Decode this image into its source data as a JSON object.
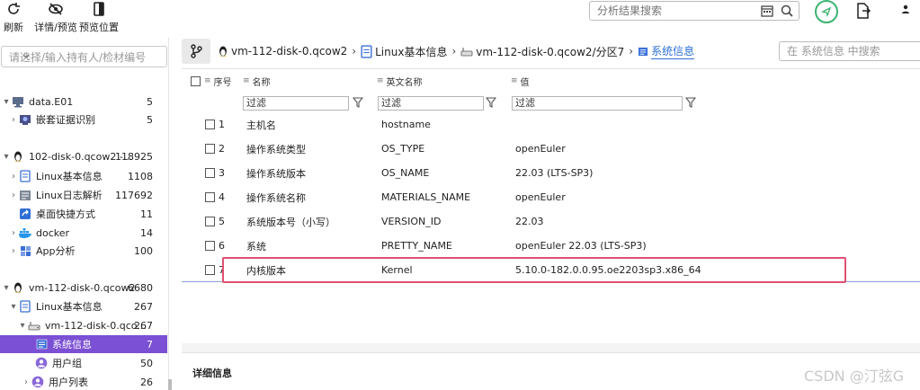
{
  "toolbar": {
    "refresh_label": "刷新",
    "details_label": "详情/预览",
    "preview_pos_label": "预览位置",
    "search_placeholder": "分析结果搜索"
  },
  "sidebar": {
    "search_placeholder": "请选择/输入持有人/检材编号",
    "items": [
      {
        "label": "data.E01",
        "count": "5",
        "icon": "monitor-icon",
        "expanded": true
      },
      {
        "label": "嵌套证据识别",
        "count": "5",
        "icon": "nested-evidence-icon",
        "expanded": false
      },
      {
        "label": "102-disk-0.qcow2 -...",
        "count": "118925",
        "icon": "linux-penguin-icon",
        "expanded": true
      },
      {
        "label": "Linux基本信息",
        "count": "1108",
        "icon": "document-icon",
        "expanded": false
      },
      {
        "label": "Linux日志解析",
        "count": "117692",
        "icon": "log-icon",
        "expanded": false
      },
      {
        "label": "桌面快捷方式",
        "count": "11",
        "icon": "shortcut-icon",
        "expanded": false
      },
      {
        "label": "docker",
        "count": "14",
        "icon": "docker-icon",
        "expanded": false
      },
      {
        "label": "App分析",
        "count": "100",
        "icon": "app-grid-icon",
        "expanded": false
      },
      {
        "label": "vm-112-disk-0.qcow2",
        "count": "6680",
        "icon": "linux-penguin-icon",
        "expanded": true
      },
      {
        "label": "Linux基本信息",
        "count": "267",
        "icon": "document-icon",
        "expanded": true
      },
      {
        "label": "vm-112-disk-0.qco...",
        "count": "267",
        "icon": "disk-icon",
        "expanded": true
      },
      {
        "label": "系统信息",
        "count": "7",
        "icon": "system-info-icon",
        "selected": true
      },
      {
        "label": "用户组",
        "count": "50",
        "icon": "user-group-icon"
      },
      {
        "label": "用户列表",
        "count": "26",
        "icon": "user-list-icon",
        "expanded": false
      }
    ]
  },
  "breadcrumb": {
    "items": [
      {
        "label": "vm-112-disk-0.qcow2",
        "icon": "linux-penguin-icon"
      },
      {
        "label": "Linux基本信息",
        "icon": "document-icon"
      },
      {
        "label": "vm-112-disk-0.qcow2/分区7",
        "icon": "disk-icon"
      },
      {
        "label": "系统信息",
        "icon": "system-info-icon"
      }
    ],
    "search_placeholder": "在 系统信息 中搜索"
  },
  "table": {
    "headers": {
      "index": "序号",
      "name": "名称",
      "en_name": "英文名称",
      "value": "值"
    },
    "filter_text": "过滤",
    "rows": [
      {
        "index": "1",
        "name": "主机名",
        "en_name": "hostname",
        "value": ""
      },
      {
        "index": "2",
        "name": "操作系统类型",
        "en_name": "OS_TYPE",
        "value": "openEuler"
      },
      {
        "index": "3",
        "name": "操作系统版本",
        "en_name": "OS_NAME",
        "value": "22.03 (LTS-SP3)"
      },
      {
        "index": "4",
        "name": "操作系统名称",
        "en_name": "MATERIALS_NAME",
        "value": "openEuler"
      },
      {
        "index": "5",
        "name": "系统版本号（小写）",
        "en_name": "VERSION_ID",
        "value": "22.03"
      },
      {
        "index": "6",
        "name": "系统",
        "en_name": "PRETTY_NAME",
        "value": "openEuler 22.03 (LTS-SP3)"
      },
      {
        "index": "7",
        "name": "内核版本",
        "en_name": "Kernel",
        "value": "5.10.0-182.0.0.95.oe2203sp3.x86_64"
      }
    ]
  },
  "detail": {
    "title": "详细信息"
  },
  "watermark": "CSDN @汀弦G",
  "colors": {
    "selected": "#7b50d4",
    "highlight": "#e05072",
    "link": "#2d6fd6",
    "sync": "#3cb371"
  }
}
